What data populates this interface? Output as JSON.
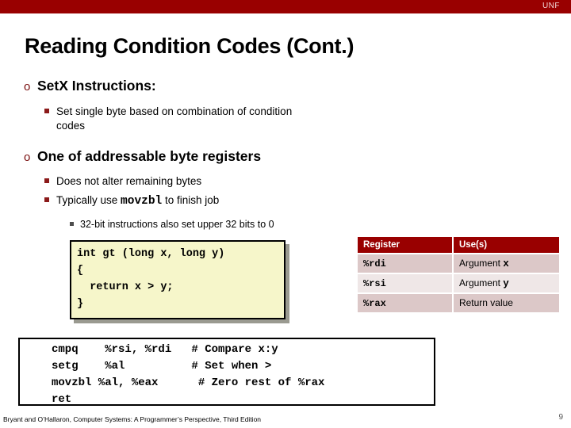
{
  "header": {
    "logo_text": "UNF",
    "bar_color": "#990000"
  },
  "slide": {
    "title": "Reading Condition Codes (Cont.)",
    "number": "9"
  },
  "bullets": {
    "b1_marker": "o",
    "b1_text": "SetX Instructions:",
    "b1_sub1": "Set single byte based on combination of condition",
    "b1_sub1_cont": "codes",
    "b2_marker": "o",
    "b2_text": "One of addressable byte registers",
    "b2_sub1": "Does not alter remaining bytes",
    "b2_sub2_pre": "Typically use ",
    "b2_sub2_mono": "movzbl",
    "b2_sub2_post": " to finish job",
    "b2_sub2_sub1": "32-bit instructions also set upper 32 bits to 0"
  },
  "c_code": {
    "text": "int gt (long x, long y)\n{\n  return x > y;\n}"
  },
  "register_table": {
    "headers": [
      "Register",
      "Use(s)"
    ],
    "rows": [
      {
        "register": "%rdi",
        "use_prefix": "Argument ",
        "use_var": "x"
      },
      {
        "register": "%rsi",
        "use_prefix": "Argument ",
        "use_var": "y"
      },
      {
        "register": "%rax",
        "use_prefix": "Return value",
        "use_var": ""
      }
    ]
  },
  "asm_code": {
    "text": "cmpq    %rsi, %rdi   # Compare x:y\nsetg    %al          # Set when >\nmovzbl %al, %eax      # Zero rest of %rax\nret"
  },
  "footer": {
    "citation": "Bryant and O’Hallaron, Computer Systems: A Programmer’s Perspective, Third Edition"
  }
}
